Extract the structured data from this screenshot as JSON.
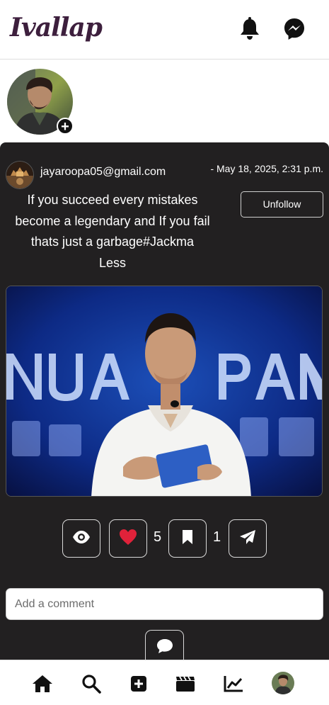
{
  "header": {
    "logo": "Ivallap",
    "icons": [
      "bell-icon",
      "messenger-icon"
    ]
  },
  "stories": {
    "add_icon": "plus-icon"
  },
  "post": {
    "username": "jayaroopa05@gmail.com",
    "timestamp": "- May 18, 2025, 2:31 p.m.",
    "caption_lines": [
      "If you succeed every mistakes",
      "become a legendary and If you fail",
      "thats just a garbage#Jackma",
      "Less"
    ],
    "unfollow_label": "Unfollow",
    "actions": {
      "view_icon": "eye-icon",
      "like_icon": "heart-icon",
      "like_count": "5",
      "save_icon": "bookmark-icon",
      "save_count": "1",
      "share_icon": "send-icon"
    },
    "comment": {
      "placeholder": "Add a comment",
      "value": "",
      "submit_icon": "comment-icon"
    }
  },
  "bottom_nav": {
    "items": [
      "home-icon",
      "search-icon",
      "add-post-icon",
      "reels-icon",
      "chart-icon",
      "profile-avatar"
    ]
  },
  "colors": {
    "card_bg": "#222021",
    "logo": "#3d1f3d",
    "heart": "#e0223a",
    "text_light": "#ffffff"
  }
}
